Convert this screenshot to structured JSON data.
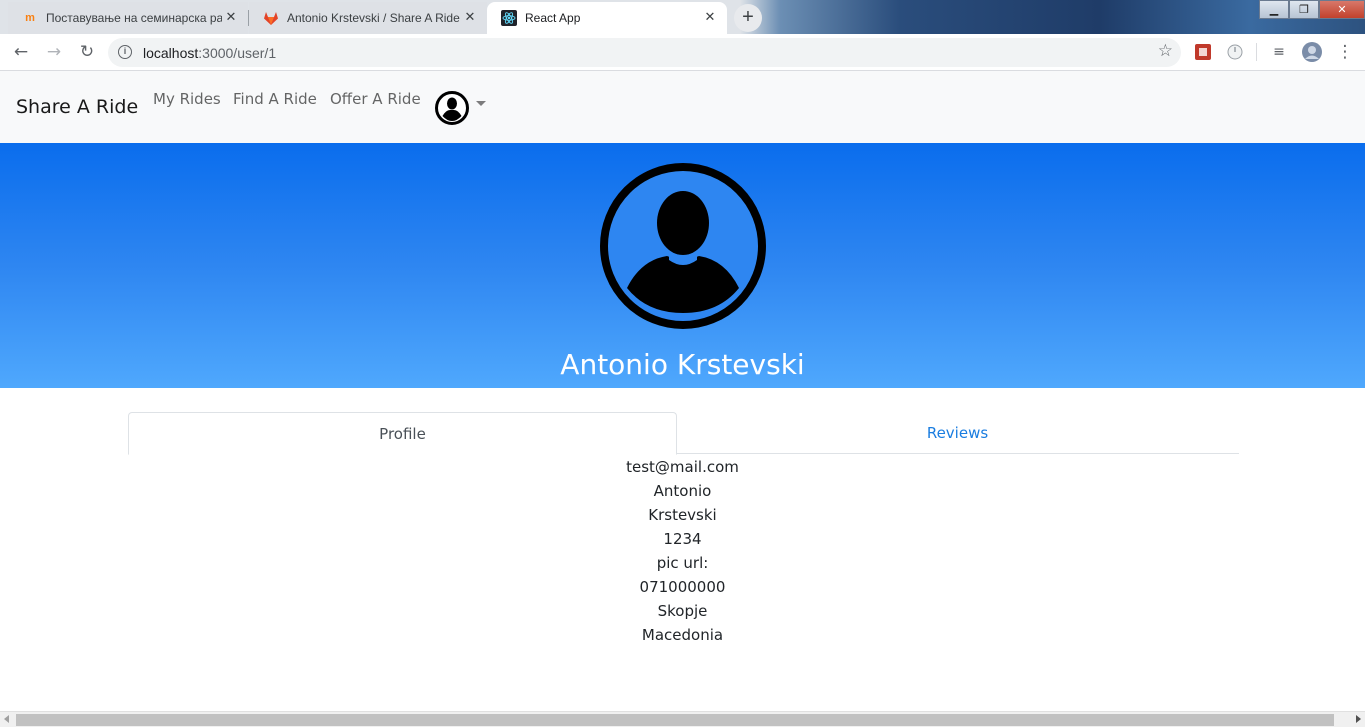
{
  "browser": {
    "tabs": [
      {
        "title": "Поставување на семинарска ра",
        "active": false
      },
      {
        "title": "Antonio Krstevski / Share A Ride",
        "active": false
      },
      {
        "title": "React App",
        "active": true
      }
    ],
    "new_tab_label": "+",
    "close_glyph": "✕",
    "url_host": "localhost",
    "url_path": ":3000/user/1"
  },
  "nav": {
    "brand": "Share A Ride",
    "links": [
      "My Rides",
      "Find A Ride",
      "Offer A Ride"
    ]
  },
  "profile": {
    "full_name": "Antonio Krstevski",
    "tabs": [
      "Profile",
      "Reviews"
    ],
    "active_tab": "Profile",
    "details": {
      "email": "test@mail.com",
      "first_name": "Antonio",
      "last_name": "Krstevski",
      "field4": "1234",
      "pic_url": "pic url:",
      "phone": "071000000",
      "city": "Skopje",
      "country": "Macedonia"
    }
  },
  "colors": {
    "hero_top": "#0a6ded",
    "hero_bottom": "#4fa8fd",
    "link": "#1a7de0",
    "navbar_bg": "#f8f9fa"
  }
}
